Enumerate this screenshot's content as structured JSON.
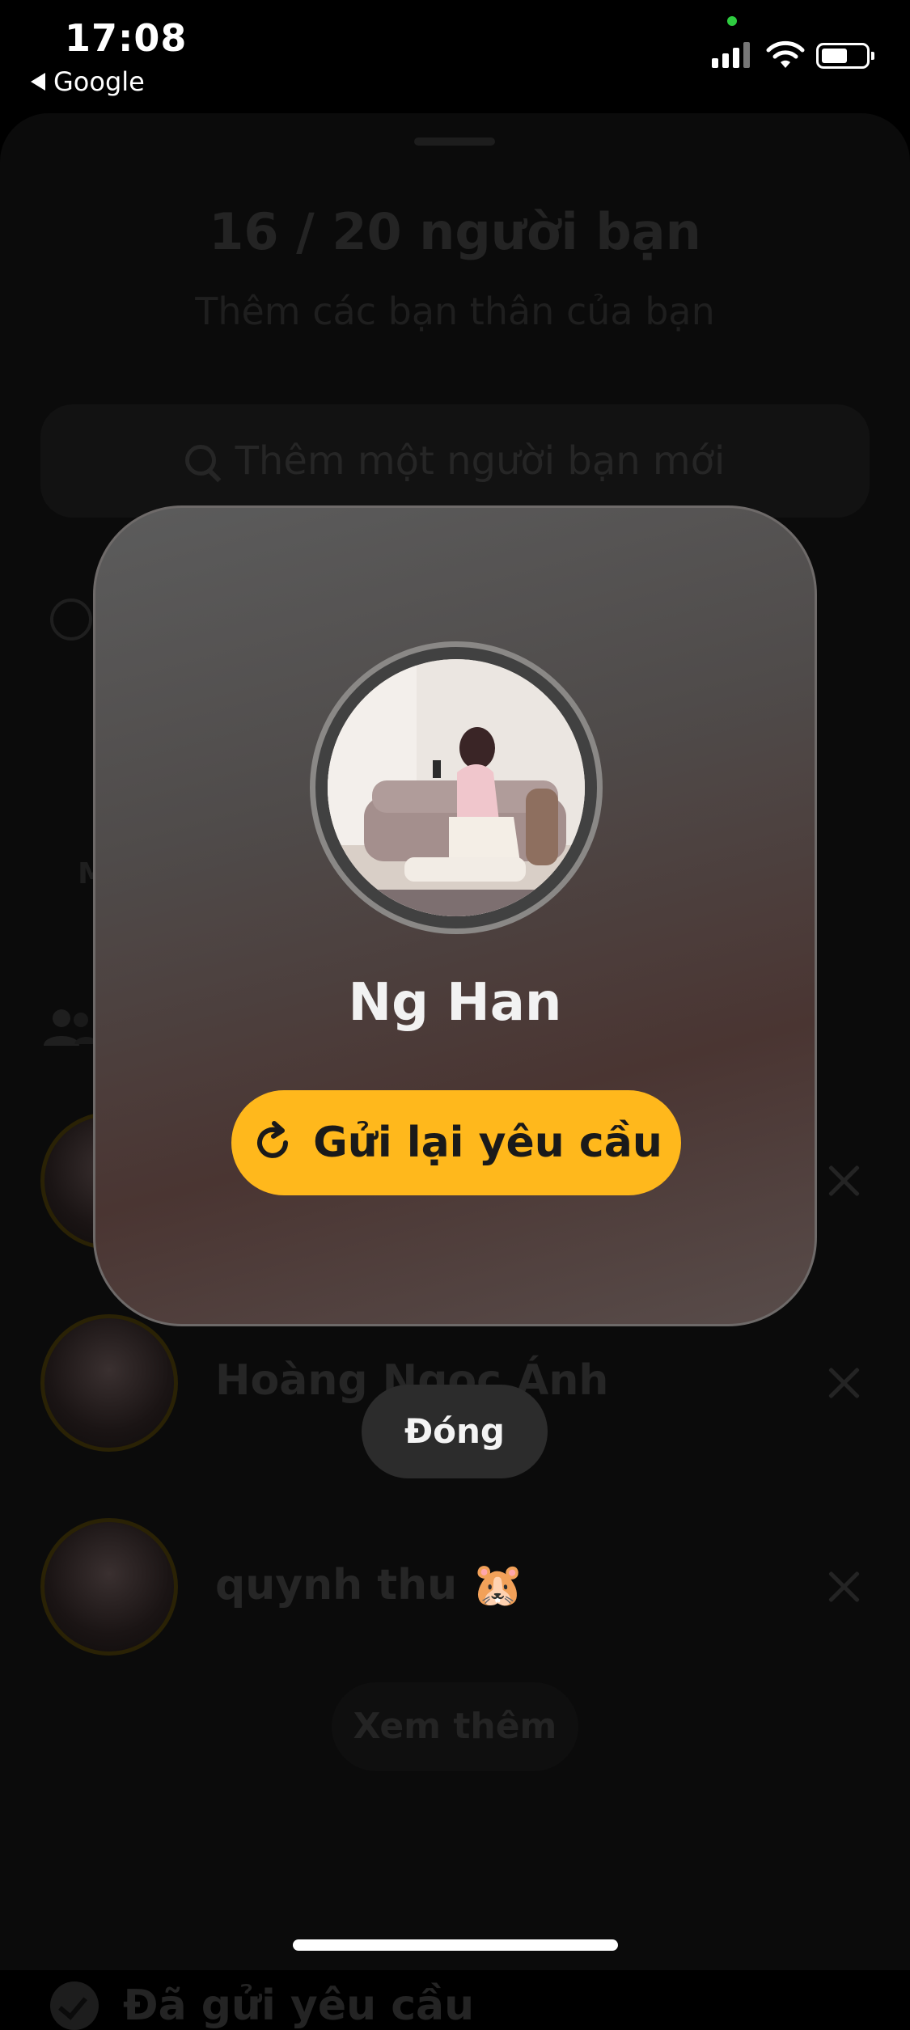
{
  "status_bar": {
    "time": "17:08",
    "back_app": "Google",
    "battery_level": 0.6
  },
  "background": {
    "title": "16 / 20 người bạn",
    "subtitle": "Thêm các bạn thân của bạn",
    "search_placeholder": "Thêm một người bạn mới",
    "section_letter": "M",
    "friends": [
      {
        "name": "",
        "remove_icon": "close-icon"
      },
      {
        "name": "Hoàng Ngọc Ánh",
        "remove_icon": "close-icon"
      },
      {
        "name": "quynh thu 🐹",
        "remove_icon": "close-icon"
      }
    ],
    "see_more": "Xem thêm",
    "sent_requests": "Đã gửi yêu cầu"
  },
  "modal": {
    "name": "Ng Han",
    "resend_label": "Gửi lại yêu cầu",
    "resend_icon": "refresh-icon",
    "accent_color": "#ffb81c"
  },
  "close_label": "Đóng"
}
